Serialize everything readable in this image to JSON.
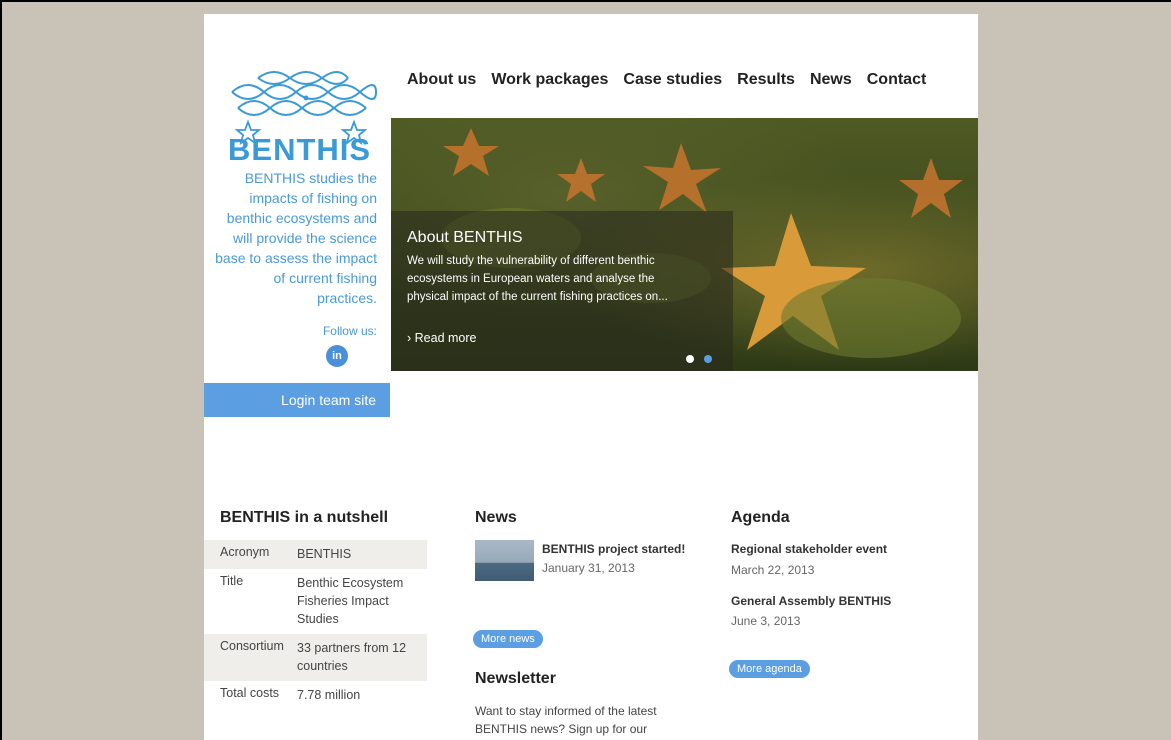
{
  "site": {
    "logo_word": "BENTHIS",
    "tagline": "BENTHIS studies the impacts of fishing on benthic ecosystems and will provide the science base to assess the impact of current fishing practices.",
    "follow_label": "Follow us:",
    "linkedin_label": "in",
    "login_label": "Login team site"
  },
  "nav": {
    "items": [
      "About us",
      "Work packages",
      "Case studies",
      "Results",
      "News",
      "Contact"
    ]
  },
  "hero": {
    "title": "About BENTHIS",
    "text": "We will study the vulnerability of different benthic ecosystems in European waters and analyse the physical impact of the current fishing practices on...",
    "read_more": "› Read more",
    "slides": 2,
    "active_slide": 1
  },
  "nutshell": {
    "title": "BENTHIS in a nutshell",
    "rows": [
      {
        "key": "Acronym",
        "value": "BENTHIS"
      },
      {
        "key": "Title",
        "value": "Benthic Ecosystem Fisheries Impact Studies"
      },
      {
        "key": "Consortium",
        "value": "33 partners from 12 countries"
      },
      {
        "key": "Total costs",
        "value": "7.78 million"
      }
    ]
  },
  "news": {
    "title": "News",
    "items": [
      {
        "title": "BENTHIS project started!",
        "date": "January 31, 2013"
      }
    ],
    "more_label": "More news"
  },
  "newsletter": {
    "title": "Newsletter",
    "text": "Want to stay informed of the latest BENTHIS news? Sign up for our"
  },
  "agenda": {
    "title": "Agenda",
    "items": [
      {
        "title": "Regional stakeholder event",
        "date": "March 22, 2013"
      },
      {
        "title": "General Assembly BENTHIS",
        "date": "June 3, 2013"
      }
    ],
    "more_label": "More agenda"
  },
  "colors": {
    "brand_blue": "#3a9ad6",
    "button_blue": "#5b9ee2",
    "backdrop": "#c9c2b6"
  }
}
